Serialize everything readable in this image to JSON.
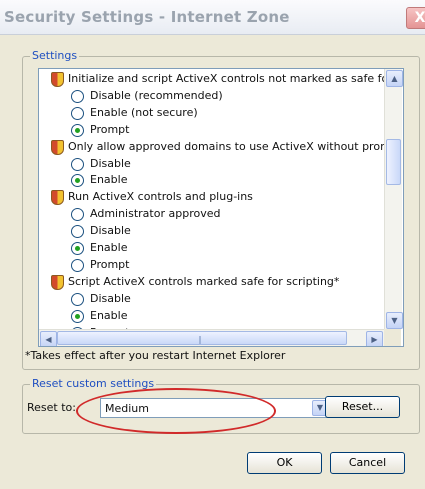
{
  "window": {
    "title": "Security Settings - Internet Zone",
    "close_glyph": "X"
  },
  "settings_group": {
    "label": "Settings"
  },
  "settings_tree": [
    {
      "type": "header",
      "text": "Initialize and script ActiveX controls not marked as safe for scripting"
    },
    {
      "type": "option",
      "text": "Disable (recommended)",
      "selected": false
    },
    {
      "type": "option",
      "text": "Enable (not secure)",
      "selected": false
    },
    {
      "type": "option",
      "text": "Prompt",
      "selected": true
    },
    {
      "type": "header",
      "text": "Only allow approved domains to use ActiveX without prompt"
    },
    {
      "type": "option",
      "text": "Disable",
      "selected": false
    },
    {
      "type": "option",
      "text": "Enable",
      "selected": true
    },
    {
      "type": "header",
      "text": "Run ActiveX controls and plug-ins"
    },
    {
      "type": "option",
      "text": "Administrator approved",
      "selected": false
    },
    {
      "type": "option",
      "text": "Disable",
      "selected": false
    },
    {
      "type": "option",
      "text": "Enable",
      "selected": true
    },
    {
      "type": "option",
      "text": "Prompt",
      "selected": false
    },
    {
      "type": "header",
      "text": "Script ActiveX controls marked safe for scripting*"
    },
    {
      "type": "option",
      "text": "Disable",
      "selected": false
    },
    {
      "type": "option",
      "text": "Enable",
      "selected": true
    },
    {
      "type": "option",
      "text": "Prompt",
      "selected": false
    }
  ],
  "note": "*Takes effect after you restart Internet Explorer",
  "reset_group": {
    "label": "Reset custom settings",
    "reset_to_label": "Reset to:",
    "selected_level": "Medium",
    "reset_button": "Reset..."
  },
  "footer": {
    "ok_button": "OK",
    "cancel_button": "Cancel"
  },
  "colors": {
    "highlight_ellipse": "#d12a2a",
    "group_label": "#1f4fc1",
    "selected_radio": "#21a121"
  }
}
